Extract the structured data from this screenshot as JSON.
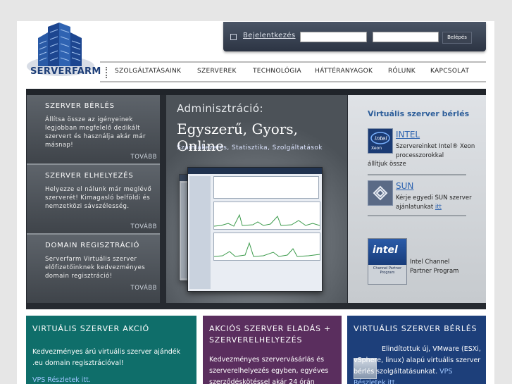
{
  "header": {
    "logo_text": "SERVERFARM",
    "login": {
      "label": "Bejelentkezés",
      "button": "Belépés"
    },
    "nav": [
      "SZOLGÁLTATÁSAINK",
      "SZERVEREK",
      "TECHNOLÓGIA",
      "HÁTTÉRANYAGOK",
      "RÓLUNK",
      "KAPCSOLAT"
    ]
  },
  "banner": {
    "left_boxes": [
      {
        "title": "SZERVER BÉRLÉS",
        "text": "Állítsa össze az igényeinek legjobban megfelelő dedikált szervert és használja akár már másnap!",
        "more": "TOVÁBB"
      },
      {
        "title": "SZERVER ELHELYEZÉS",
        "text": "Helyezze el nálunk már meglévő szerverét! Kimagasló belföldi és nemzetközi sávszélesség.",
        "more": "TOVÁBB"
      },
      {
        "title": "DOMAIN REGISZTRÁCIÓ",
        "text": "Serverfarm Virtuális szerver előfizetőinknek kedvezményes domain regisztráció!",
        "more": "TOVÁBB"
      }
    ],
    "middle": {
      "heading": "Adminisztráció:",
      "tagline": "Egyszerű, Gyors, Online",
      "sub": "Számlakezelés, Statisztika, Szolgáltatások"
    },
    "right": {
      "title": "Virtuális szerver bérlés",
      "intel": {
        "link": "INTEL",
        "text": "Szervereinket Intel® Xeon processzorokkal",
        "text2": "állítjuk össze"
      },
      "sun": {
        "link": "SUN",
        "text": "Kérje egyedi SUN szerver ajánlatunkat",
        "in": "itt"
      },
      "channel": {
        "logo": "intel",
        "badge": "Channel Partner Program",
        "text": "Intel Channel Partner Program"
      }
    }
  },
  "boxes": [
    {
      "title": "VIRTUÁLIS SZERVER AKCIÓ",
      "text": "Kedvezményes árú virtuális szerver ajándék .eu domain regisztrációval!",
      "link": "VPS Részletek itt."
    },
    {
      "title": "AKCIÓS SZERVER ELADÁS + SZERVERELHELYEZÉS",
      "text": "Kedvezményes szervervásárlás és szerverelhelyezés egyben, egyéves szerződéskötéssel akár 24 órán"
    },
    {
      "title": "VIRTUÁLIS SZERVER BÉRLÉS",
      "text": "Elindítottuk új, VMware (ESXi, vSphere, linux) alapú virtuális szerver bérlés szolgáltatásunkat.",
      "link": "VPS Részletek itt."
    }
  ],
  "colors": {
    "teal": "#0f6e6a",
    "purple": "#5a2e5e",
    "navy": "#1d3f7a",
    "brand": "#1d3e78"
  }
}
